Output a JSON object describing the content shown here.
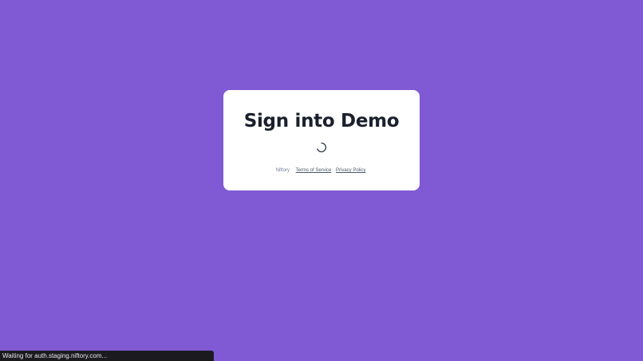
{
  "card": {
    "title": "Sign into Demo",
    "loading_icon": "spinner-icon"
  },
  "footer": {
    "brand": "Niftory",
    "links": [
      {
        "label": "Terms of Service"
      },
      {
        "label": "Privacy Policy"
      }
    ]
  },
  "status_bar": {
    "text": "Waiting for auth.staging.niftory.com..."
  },
  "colors": {
    "background": "#805ad5",
    "card": "#ffffff",
    "title": "#1a202c",
    "status_bar": "#1b1b1f"
  }
}
